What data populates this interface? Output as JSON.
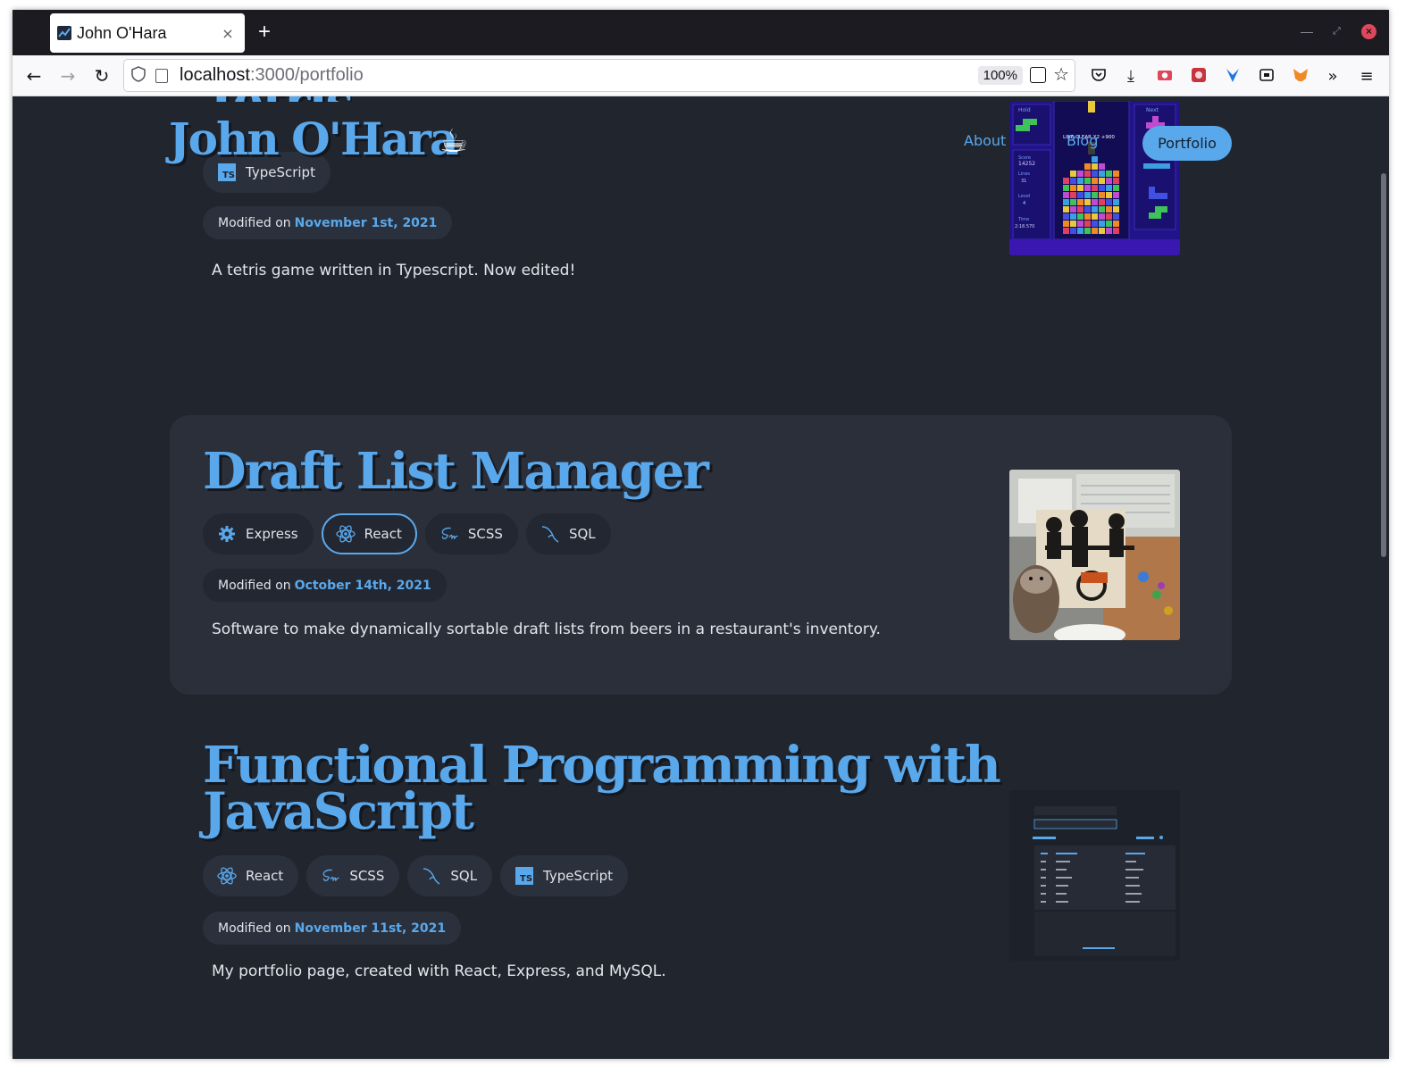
{
  "browser": {
    "tab_title": "John O'Hara",
    "new_tab": "+",
    "tab_close": "×",
    "url_host": "localhost",
    "url_path": ":3000/portfolio",
    "zoom": "100%"
  },
  "site": {
    "logo": "John O'Hara",
    "logo_icon": "coffee-cup-icon",
    "nav": {
      "about": "About",
      "blog": "Blog",
      "portfolio": "Portfolio"
    }
  },
  "projects": [
    {
      "title": "Tetris",
      "tags": [
        "TypeScript"
      ],
      "modified_prefix": "Modified on",
      "modified_date": "November 1st, 2021",
      "description": "A tetris game written in Typescript. Now edited!"
    },
    {
      "title": "Draft List Manager",
      "tags": [
        "Express",
        "React",
        "SCSS",
        "SQL"
      ],
      "active_tag": "React",
      "modified_prefix": "Modified on",
      "modified_date": "October 14th, 2021",
      "description": "Software to make dynamically sortable draft lists from beers in a restaurant's inventory."
    },
    {
      "title": "Functional Programming with JavaScript",
      "tags": [
        "React",
        "SCSS",
        "SQL",
        "TypeScript"
      ],
      "modified_prefix": "Modified on",
      "modified_date": "November 11st, 2021",
      "description": "My portfolio page, created with React, Express, and MySQL."
    }
  ],
  "tetris_thumb": {
    "hold": "Hold",
    "next": "Next",
    "line_clear": "LINE CLEAR X2 +900",
    "score_label": "Score",
    "score": "14252",
    "lines_label": "Lines",
    "lines": "31",
    "level_label": "Level",
    "level": "4",
    "time_label": "Time",
    "time": "2:18.570"
  },
  "colors": {
    "accent": "#5aa8ec",
    "page_bg": "#21252e",
    "card_bg": "#2a2f39",
    "tag_bg": "#2b313c"
  }
}
